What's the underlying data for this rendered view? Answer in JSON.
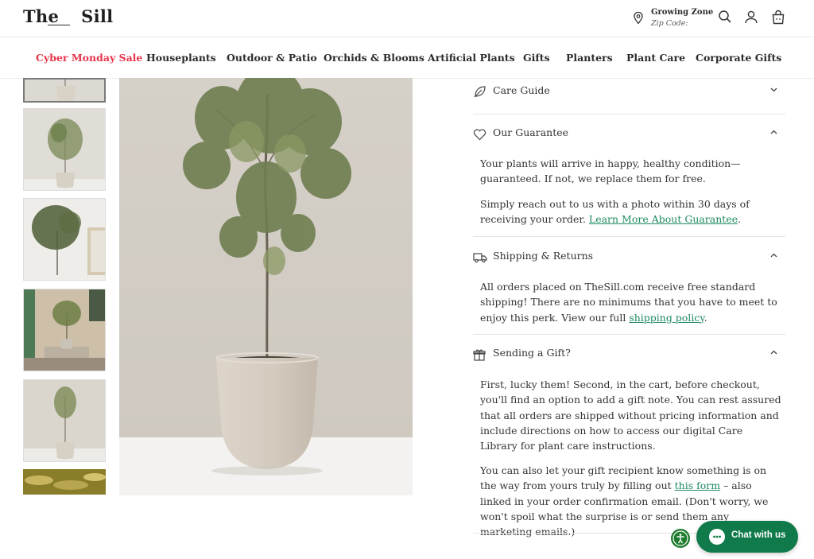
{
  "brand": {
    "logo_left": "The",
    "logo_right": "Sill"
  },
  "header": {
    "growing_zone_title": "Growing Zone",
    "zip_label": "Zip Code:",
    "icons": [
      "location-pin-icon",
      "search-icon",
      "account-icon",
      "cart-icon"
    ]
  },
  "nav": {
    "items": [
      {
        "label": "Cyber Monday Sale",
        "highlight": true
      },
      {
        "label": "Houseplants"
      },
      {
        "label": "Outdoor & Patio"
      },
      {
        "label": "Orchids & Blooms"
      },
      {
        "label": "Artificial Plants"
      },
      {
        "label": "Gifts"
      },
      {
        "label": "Planters"
      },
      {
        "label": "Plant Care"
      },
      {
        "label": "Corporate Gifts"
      }
    ],
    "sale_color": "#e8344a"
  },
  "gallery": {
    "thumbnail_count": 6,
    "active_thumbnail": 0
  },
  "accordion": {
    "care_guide": {
      "title": "Care Guide",
      "expanded": false
    },
    "guarantee": {
      "title": "Our Guarantee",
      "expanded": true,
      "p1": "Your plants will arrive in happy, healthy condition—guaranteed. If not, we replace them for free.",
      "p2_text": "Simply reach out to us with a photo within 30 days of receiving your order.",
      "p2_link": "Learn More About Guarantee",
      "p2_end": "."
    },
    "shipping": {
      "title": "Shipping & Returns",
      "expanded": true,
      "p1_text": "All orders placed on TheSill.com receive free standard shipping! There are no minimums that you have to meet to enjoy this perk. View our full",
      "p1_link": "shipping policy",
      "p1_end": "."
    },
    "gift": {
      "title": "Sending a Gift?",
      "expanded": true,
      "p1": "First, lucky them! Second, in the cart, before checkout, you'll find an option to add a gift note. You can rest assured that all orders are shipped without pricing information and include directions on how to access our digital Care Library for plant care instructions.",
      "p2_text": "You can also let your gift recipient know something is on the way from yours truly by filling out",
      "p2_link": "this form",
      "p2_end": " – also linked in your order confirmation email. (Don't worry, we won't spoil what the surprise is or send them any marketing emails.)"
    },
    "link_color": "#1f8a60"
  },
  "chat": {
    "label": "Chat with us",
    "color": "#107a4a"
  }
}
